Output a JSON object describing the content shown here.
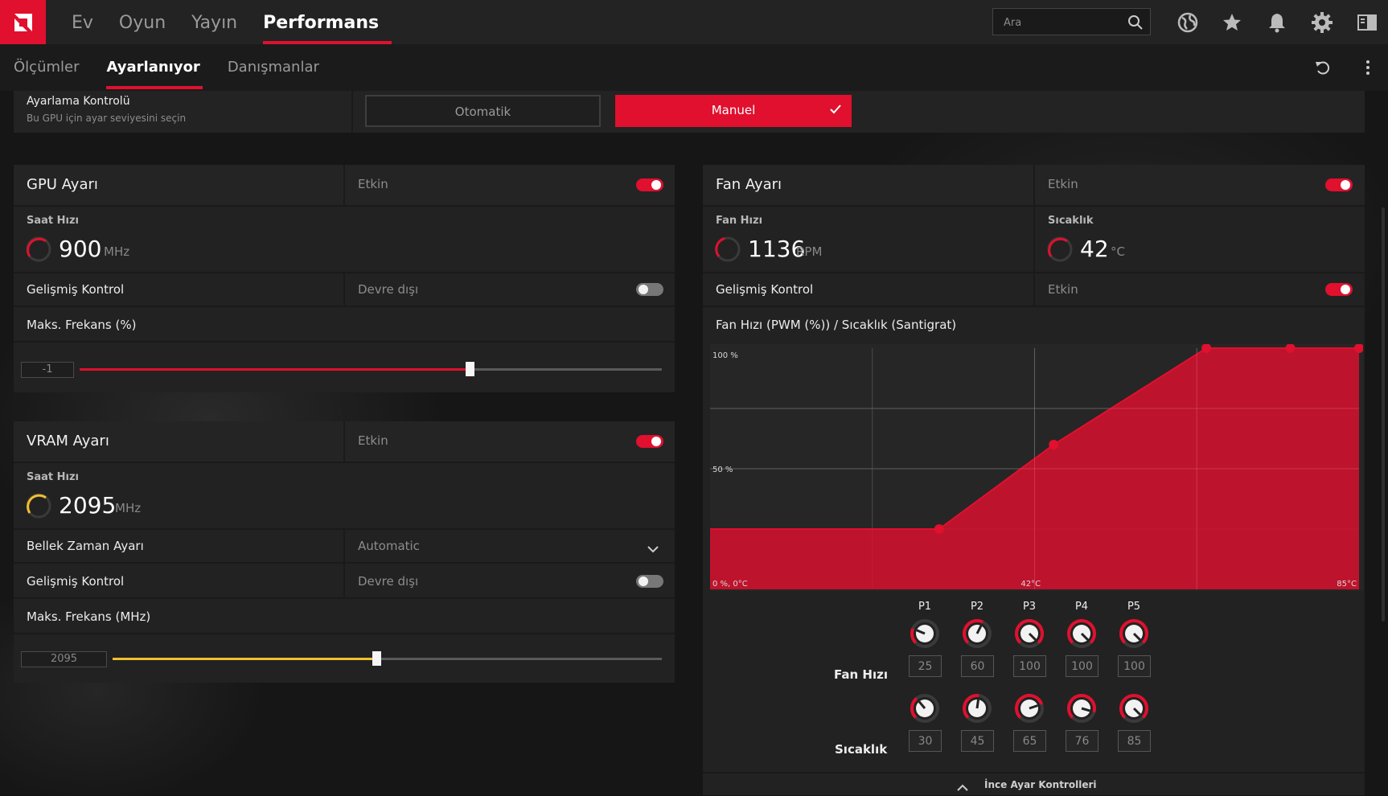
{
  "topnav": {
    "tabs": [
      "Ev",
      "Oyun",
      "Yayın",
      "Performans"
    ],
    "active": "Performans"
  },
  "search": {
    "placeholder": "Ara"
  },
  "subnav": {
    "tabs": [
      "Ölçümler",
      "Ayarlanıyor",
      "Danışmanlar"
    ],
    "active": "Ayarlanıyor"
  },
  "tuning_control": {
    "title": "Ayarlama Kontrolü",
    "subtitle": "Bu GPU için ayar seviyesini seçin",
    "auto_label": "Otomatik",
    "manual_label": "Manuel",
    "selected": "Manuel"
  },
  "gpu": {
    "title": "GPU Ayarı",
    "state": "Etkin",
    "enabled": true,
    "clock_label": "Saat Hızı",
    "clock_value": "900",
    "clock_unit": "MHz",
    "advanced_label": "Gelişmiş Kontrol",
    "advanced_state": "Devre dışı",
    "advanced_enabled": false,
    "max_freq_label": "Maks. Frekans (%)",
    "max_freq_value": "-1",
    "max_freq_slider_fraction": 0.67
  },
  "vram": {
    "title": "VRAM Ayarı",
    "state": "Etkin",
    "enabled": true,
    "clock_label": "Saat Hızı",
    "clock_value": "2095",
    "clock_unit": "MHz",
    "timing_label": "Bellek Zaman Ayarı",
    "timing_value": "Automatic",
    "advanced_label": "Gelişmiş Kontrol",
    "advanced_state": "Devre dışı",
    "advanced_enabled": false,
    "max_freq_label": "Maks. Frekans (MHz)",
    "max_freq_value": "2095",
    "max_freq_slider_fraction": 0.48
  },
  "fan": {
    "title": "Fan Ayarı",
    "state": "Etkin",
    "enabled": true,
    "speed_label": "Fan Hızı",
    "speed_value": "1136",
    "speed_unit": "RPM",
    "temp_label": "Sıcaklık",
    "temp_value": "42",
    "temp_unit": "°C",
    "advanced_label": "Gelişmiş Kontrol",
    "advanced_state": "Etkin",
    "advanced_enabled": true,
    "curve_title": "Fan Hızı (PWM (%)) / Sıcaklık (Santigrat)",
    "fine_tune_label": "İnce Ayar Kontrolleri",
    "row_speed_label": "Fan Hızı",
    "row_temp_label": "Sıcaklık"
  },
  "chart_data": {
    "type": "area",
    "title": "Fan Hızı (PWM (%)) / Sıcaklık (Santigrat)",
    "y_ticks": [
      "100 %",
      "50 %",
      "0 %, 0°C"
    ],
    "x_ticks": [
      "42°C",
      "85°C"
    ],
    "points": [
      "P1",
      "P2",
      "P3",
      "P4",
      "P5"
    ],
    "fan_speed": [
      25,
      60,
      100,
      100,
      100
    ],
    "temperature": [
      30,
      45,
      65,
      76,
      85
    ],
    "xlim": [
      0,
      85
    ],
    "ylim": [
      0,
      100
    ],
    "color": "#e0102e"
  },
  "colors": {
    "accent": "#e0102e",
    "vram_accent": "#f1bf2f"
  },
  "icons": [
    "amd-logo-icon",
    "search-icon",
    "globe-icon",
    "star-icon",
    "bell-icon",
    "gear-icon",
    "panel-icon",
    "reset-icon",
    "more-icon",
    "check-icon",
    "chevron-down-icon",
    "chevron-up-icon"
  ]
}
